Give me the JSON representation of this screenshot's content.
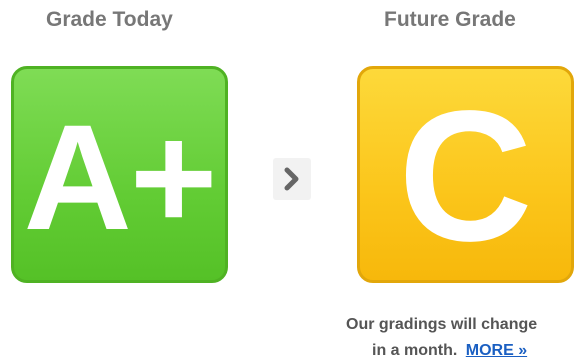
{
  "today": {
    "title": "Grade Today",
    "grade": "A+",
    "color": "#62cc34"
  },
  "future": {
    "title": "Future Grade",
    "grade": "C",
    "color": "#fbc51a"
  },
  "arrow_icon": "chevron-right-icon",
  "note": {
    "line1": "Our gradings will change",
    "line2": "in a month.",
    "link_label": "MORE »",
    "link_color": "#1a5fc2"
  }
}
